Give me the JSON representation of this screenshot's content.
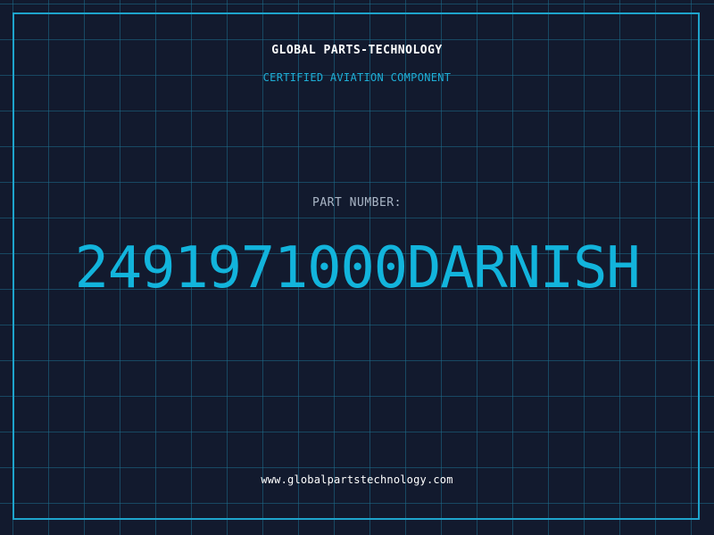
{
  "header": {
    "brand": "GLOBAL PARTS-TECHNOLOGY",
    "tagline": "CERTIFIED AVIATION COMPONENT"
  },
  "part": {
    "label": "PART NUMBER:",
    "number": "2491971000DARNISH"
  },
  "footer": {
    "website": "www.globalpartstechnology.com"
  },
  "colors": {
    "background": "#121a2e",
    "grid": "#1e6e8c",
    "frame": "#1ea4cc",
    "accent": "#12b4dc",
    "label": "#aab6c6",
    "text": "#ffffff"
  }
}
